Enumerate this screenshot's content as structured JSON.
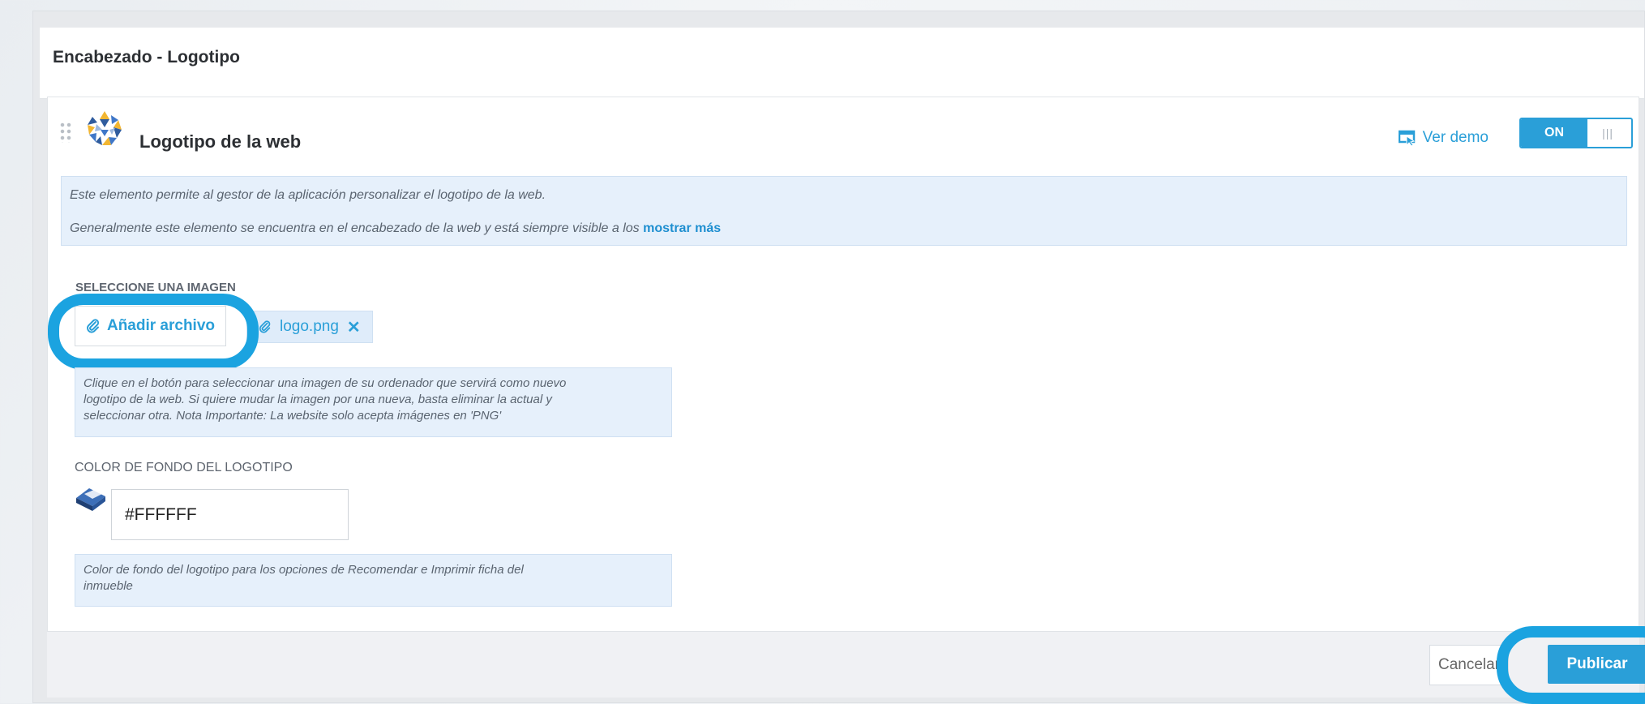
{
  "panel": {
    "title": "Encabezado - Logotipo"
  },
  "card": {
    "title": "Logotipo de la web",
    "ver_demo": "Ver demo",
    "toggle": {
      "on_label": "ON",
      "grip": "|||"
    }
  },
  "info": {
    "line1": "Este elemento permite al gestor de la aplicación personalizar el logotipo de la web.",
    "line2": "Generalmente este elemento se encuentra en el encabezado de la web y está siempre visible a los",
    "more_link": "mostrar más"
  },
  "image_section": {
    "label": "SELECCIONE UNA IMAGEN",
    "add_button": "Añadir archivo",
    "file_name": "logo.png",
    "remove_icon": "✕",
    "help": [
      "Clique en el botón para seleccionar una imagen de su ordenador que servirá como nuevo",
      "logotipo de la web. Si quiere mudar la imagen por una nueva, basta eliminar la actual y",
      "seleccionar otra. Nota Importante: La website solo acepta imágenes en 'PNG'"
    ]
  },
  "color_section": {
    "label": "COLOR DE FONDO DEL LOGOTIPO",
    "value": "#FFFFFF",
    "help": [
      "Color de fondo del logotipo para los opciones de Recomendar e Imprimir ficha del",
      "inmueble"
    ]
  },
  "footer": {
    "cancel": "Cancelar",
    "publish": "Publicar"
  },
  "colors": {
    "accent": "#2a9fd8",
    "highlight": "#1ba3e0",
    "info_bg": "#e6f0fb"
  },
  "icons": [
    "drag-handle-icon",
    "logo-icon",
    "demo-cursor-icon",
    "paperclip-icon",
    "eraser-icon",
    "close-icon"
  ]
}
